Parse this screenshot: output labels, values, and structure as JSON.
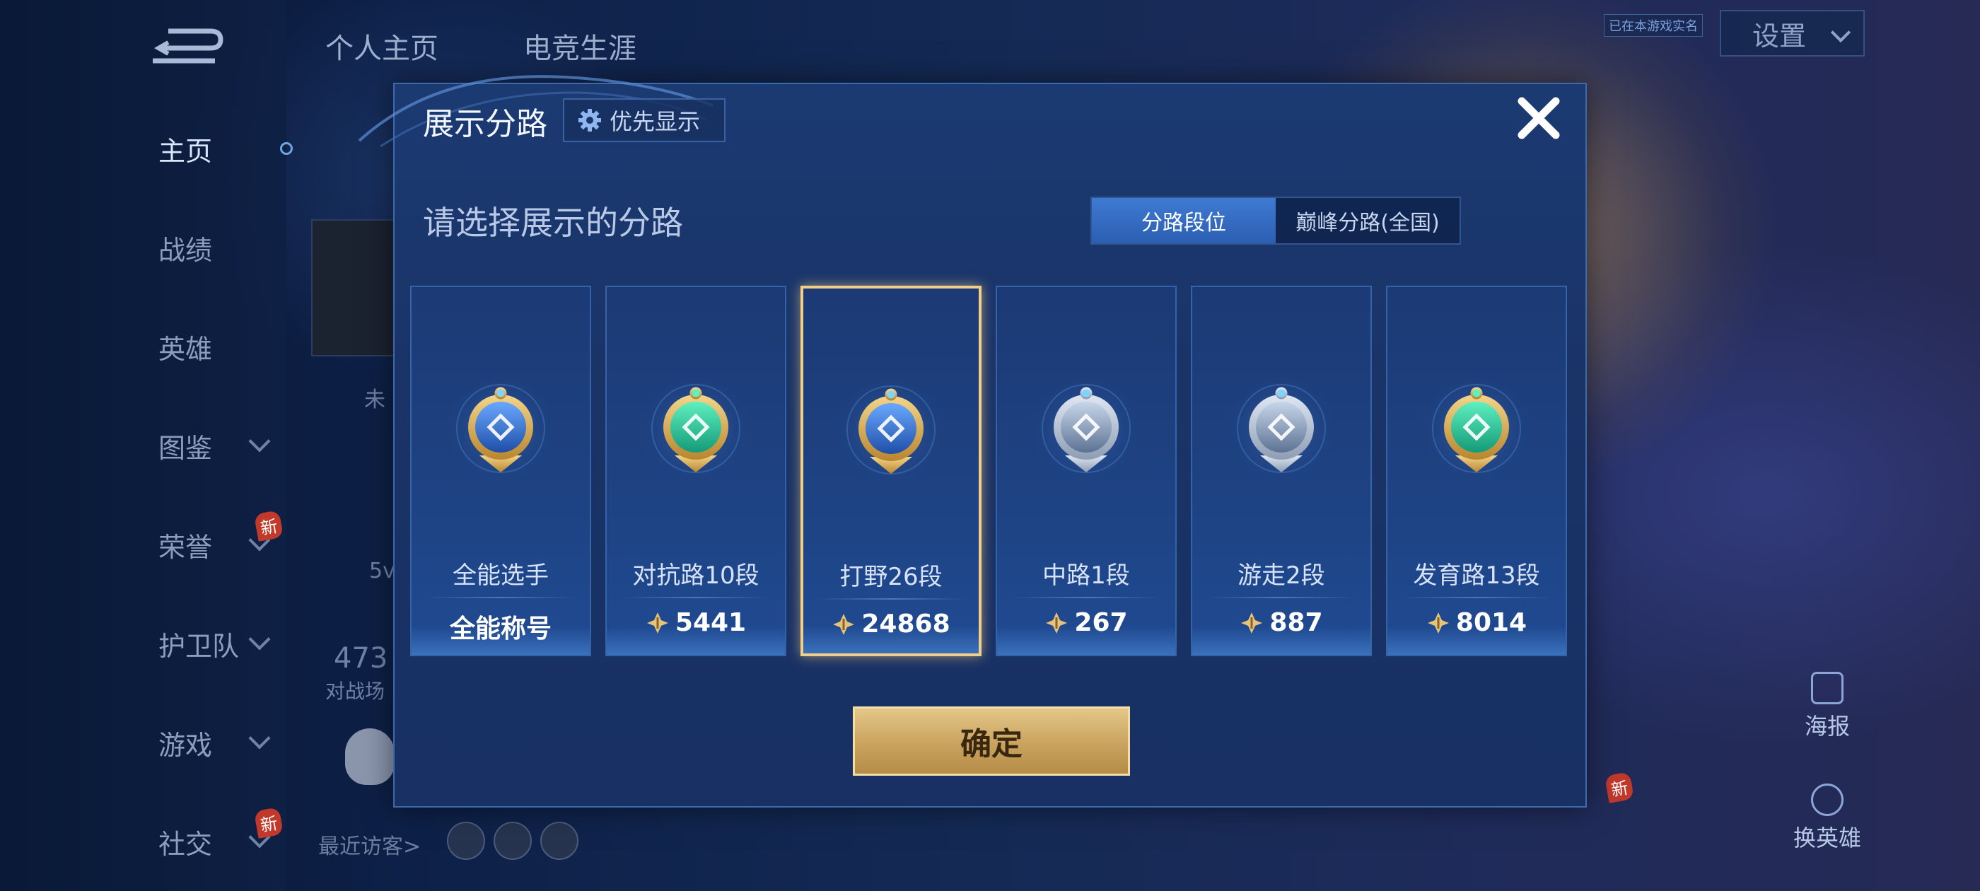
{
  "background": {
    "top_tabs": [
      "个人主页",
      "电竞生涯"
    ],
    "settings_label": "设置",
    "live_tag": "已在本游戏实名",
    "sidebar": {
      "items": [
        {
          "label": "主页",
          "active": true,
          "chevron": false
        },
        {
          "label": "战绩",
          "active": false,
          "chevron": false
        },
        {
          "label": "英雄",
          "active": false,
          "chevron": false
        },
        {
          "label": "图鉴",
          "active": false,
          "chevron": true
        },
        {
          "label": "荣誉",
          "active": false,
          "chevron": true,
          "badge": "新"
        },
        {
          "label": "护卫队",
          "active": false,
          "chevron": true
        },
        {
          "label": "游戏",
          "active": false,
          "chevron": true
        },
        {
          "label": "社交",
          "active": false,
          "chevron": true,
          "badge": "新"
        }
      ]
    },
    "profile_fragments": [
      "未",
      "5v",
      "473",
      "对战场"
    ],
    "recent_visitors_label": "最近访客>",
    "right_buttons": [
      {
        "label": "海报",
        "icon": "poster-icon"
      },
      {
        "label": "换英雄",
        "icon": "swap-hero-icon",
        "badge": "新"
      }
    ]
  },
  "modal": {
    "title": "展示分路",
    "priority_label": "优先显示",
    "subtitle": "请选择展示的分路",
    "segments": [
      {
        "label": "分路段位",
        "active": true
      },
      {
        "label": "巅峰分路(全国)",
        "active": false
      }
    ],
    "cards": [
      {
        "name": "全能选手",
        "value": "全能称号",
        "has_points_icon": false,
        "badge": "all-round-badge-icon",
        "frame": "gold",
        "emblem": "blue",
        "selected": false
      },
      {
        "name": "对抗路10段",
        "value": "5441",
        "has_points_icon": true,
        "badge": "clash-lane-badge-icon",
        "frame": "gold",
        "emblem": "green",
        "selected": false
      },
      {
        "name": "打野26段",
        "value": "24868",
        "has_points_icon": true,
        "badge": "jungle-badge-icon",
        "frame": "gold",
        "emblem": "blue",
        "selected": true
      },
      {
        "name": "中路1段",
        "value": "267",
        "has_points_icon": true,
        "badge": "mid-lane-badge-icon",
        "frame": "silver",
        "emblem": "steel",
        "selected": false
      },
      {
        "name": "游走2段",
        "value": "887",
        "has_points_icon": true,
        "badge": "roam-badge-icon",
        "frame": "silver",
        "emblem": "steel",
        "selected": false
      },
      {
        "name": "发育路13段",
        "value": "8014",
        "has_points_icon": true,
        "badge": "farm-lane-badge-icon",
        "frame": "gold",
        "emblem": "green",
        "selected": false
      }
    ],
    "confirm_label": "确定"
  },
  "colors": {
    "accent_blue": "#2b5fb2",
    "gold": "#c9a35e",
    "selected_border": "#f0cf8a"
  }
}
